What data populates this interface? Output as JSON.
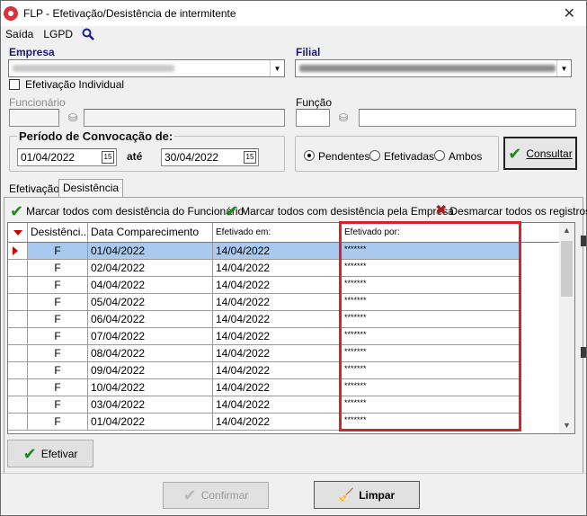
{
  "window": {
    "title": "FLP - Efetivação/Desistência de intermitente",
    "close_glyph": "✕"
  },
  "menu": {
    "saida": "Saída",
    "lgpd": "LGPD"
  },
  "form": {
    "empresa_label": "Empresa",
    "filial_label": "Filial",
    "empresa_value": "",
    "filial_value": "",
    "efetivacao_individual_label": "Efetivação Individual",
    "efetivacao_individual_checked": false,
    "funcionario_label": "Funcionário",
    "funcionario_code": "",
    "funcionario_name": "",
    "funcao_label": "Função",
    "funcao_code": "",
    "funcao_name": "",
    "periodo_label": "Período de Convocação de:",
    "data_de": "01/04/2022",
    "ate_label": "até",
    "data_ate": "30/04/2022",
    "calendar_glyph": "15"
  },
  "filter": {
    "pendentes": "Pendentes",
    "efetivadas": "Efetivadas",
    "ambos": "Ambos",
    "selected": "Pendentes"
  },
  "buttons": {
    "consultar": "Consultar",
    "efetivar": "Efetivar",
    "confirmar": "Confirmar",
    "limpar": "Limpar"
  },
  "tabs": [
    {
      "label": "Efetivação",
      "active": false
    },
    {
      "label": "Desistência",
      "active": true
    }
  ],
  "actions": {
    "marcar_funcionario": "Marcar todos com desistência do Funcionário",
    "marcar_empresa": "Marcar todos com desistência pela Empresa",
    "desmarcar": "Desmarcar todos os registros"
  },
  "grid": {
    "columns": [
      "Desistênci...",
      "Data Comparecimento",
      "Efetivado em:",
      "Efetivado por:"
    ],
    "rows": [
      {
        "desist": "F",
        "data": "01/04/2022",
        "efetivado_em": "14/04/2022",
        "efetivado_por": "*******",
        "selected": true
      },
      {
        "desist": "F",
        "data": "02/04/2022",
        "efetivado_em": "14/04/2022",
        "efetivado_por": "*******"
      },
      {
        "desist": "F",
        "data": "04/04/2022",
        "efetivado_em": "14/04/2022",
        "efetivado_por": "*******"
      },
      {
        "desist": "F",
        "data": "05/04/2022",
        "efetivado_em": "14/04/2022",
        "efetivado_por": "*******"
      },
      {
        "desist": "F",
        "data": "06/04/2022",
        "efetivado_em": "14/04/2022",
        "efetivado_por": "*******"
      },
      {
        "desist": "F",
        "data": "07/04/2022",
        "efetivado_em": "14/04/2022",
        "efetivado_por": "*******"
      },
      {
        "desist": "F",
        "data": "08/04/2022",
        "efetivado_em": "14/04/2022",
        "efetivado_por": "*******"
      },
      {
        "desist": "F",
        "data": "09/04/2022",
        "efetivado_em": "14/04/2022",
        "efetivado_por": "*******"
      },
      {
        "desist": "F",
        "data": "10/04/2022",
        "efetivado_em": "14/04/2022",
        "efetivado_por": "*******"
      },
      {
        "desist": "F",
        "data": "03/04/2022",
        "efetivado_em": "14/04/2022",
        "efetivado_por": "*******"
      },
      {
        "desist": "F",
        "data": "01/04/2022",
        "efetivado_em": "14/04/2022",
        "efetivado_por": "*******"
      }
    ]
  },
  "colors": {
    "selection": "#a9c9ee",
    "highlight_box": "#d8232a",
    "check_green": "#1c8a1c",
    "label_blue": "#1a1a6e"
  }
}
